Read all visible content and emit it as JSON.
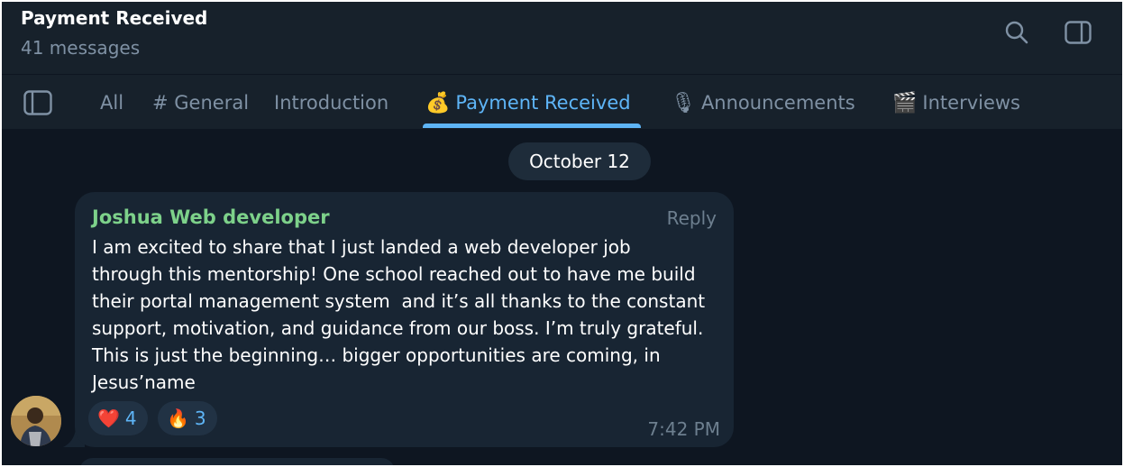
{
  "header": {
    "title": "Payment Received",
    "subtitle": "41 messages",
    "icons": [
      "search-icon",
      "side-panel-icon"
    ]
  },
  "tabs": [
    {
      "label": "All",
      "emoji": ""
    },
    {
      "label": "# General",
      "emoji": ""
    },
    {
      "label": "Introduction",
      "emoji": ""
    },
    {
      "label": "Payment Received",
      "emoji": "💰",
      "active": true
    },
    {
      "label": "Announcements",
      "emoji": "🎙"
    },
    {
      "label": "Interviews",
      "emoji": "🎬"
    }
  ],
  "date_chip": "October 12",
  "message": {
    "sender": "Joshua Web developer",
    "reply_label": "Reply",
    "text": "I am excited to share that I just landed a web developer job\nthrough this mentorship! One school reached out to have me build\ntheir portal management system  and it’s all thanks to the constant\nsupport, motivation, and guidance from our boss. I’m truly grateful.\nThis is just the beginning… bigger opportunities are coming, in\nJesus’name",
    "reactions": [
      {
        "emoji": "❤️",
        "count": "4"
      },
      {
        "emoji": "🔥",
        "count": "3"
      }
    ],
    "time": "7:42 PM"
  },
  "colors": {
    "background": "#0e1621",
    "header": "#17212b",
    "accent": "#5eb5f7",
    "sender_name": "#7dd18a",
    "bubble": "#182533"
  }
}
